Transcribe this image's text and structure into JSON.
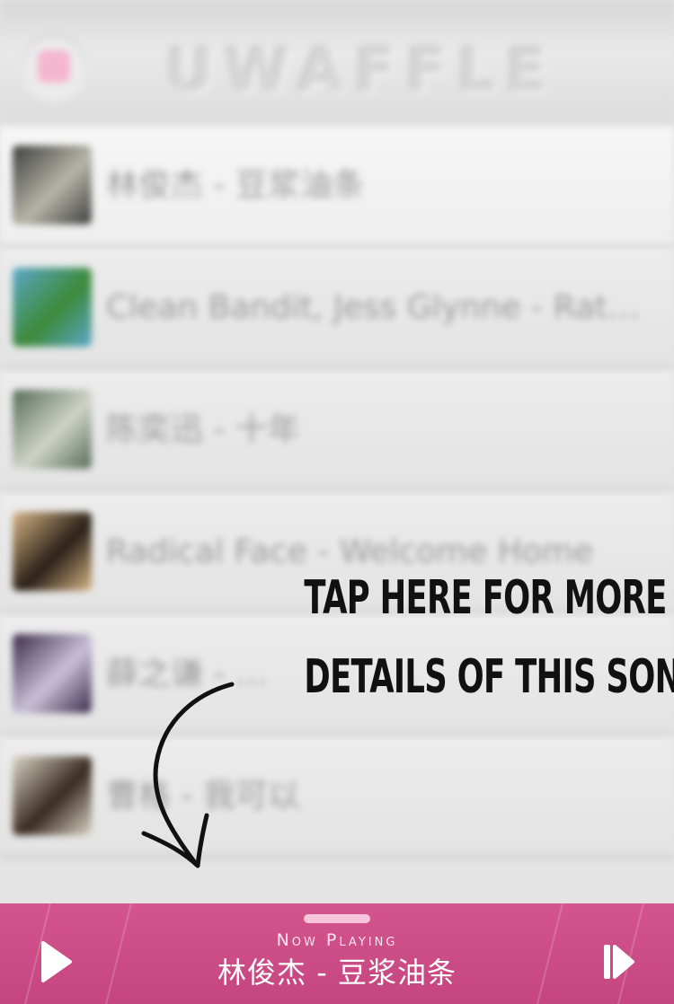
{
  "app": {
    "logo_text": "UWAFFLE"
  },
  "playlist": [
    {
      "title": "林俊杰 - 豆浆油条",
      "active": true,
      "thumb_color": "#3d3d3d",
      "thumb_accent": "#b5b5a8"
    },
    {
      "title": "Clean Bandit, Jess Glynne - Rat…",
      "active": false,
      "thumb_color": "#5aa7c8",
      "thumb_accent": "#3d8a3a"
    },
    {
      "title": "陈奕迅 - 十年",
      "active": false,
      "thumb_color": "#556b55",
      "thumb_accent": "#cfd4c8"
    },
    {
      "title": "Radical Face - Welcome Home",
      "active": false,
      "thumb_color": "#d8b585",
      "thumb_accent": "#2a2018"
    },
    {
      "title": "薛之谦 - …",
      "active": false,
      "thumb_color": "#3a2a4a",
      "thumb_accent": "#c9c0d8"
    },
    {
      "title": "曹格 - 我可以",
      "active": false,
      "thumb_color": "#d9d4c4",
      "thumb_accent": "#3a2a20"
    }
  ],
  "callout": {
    "line1": "TAP HERE FOR MORE",
    "line2": "DETAILS OF THIS SONG"
  },
  "now_playing": {
    "label": "Now Playing",
    "title": "林俊杰 - 豆浆油条",
    "play_icon": "play-icon",
    "next_icon": "next-track-icon",
    "bar_color": "#d4548d"
  }
}
